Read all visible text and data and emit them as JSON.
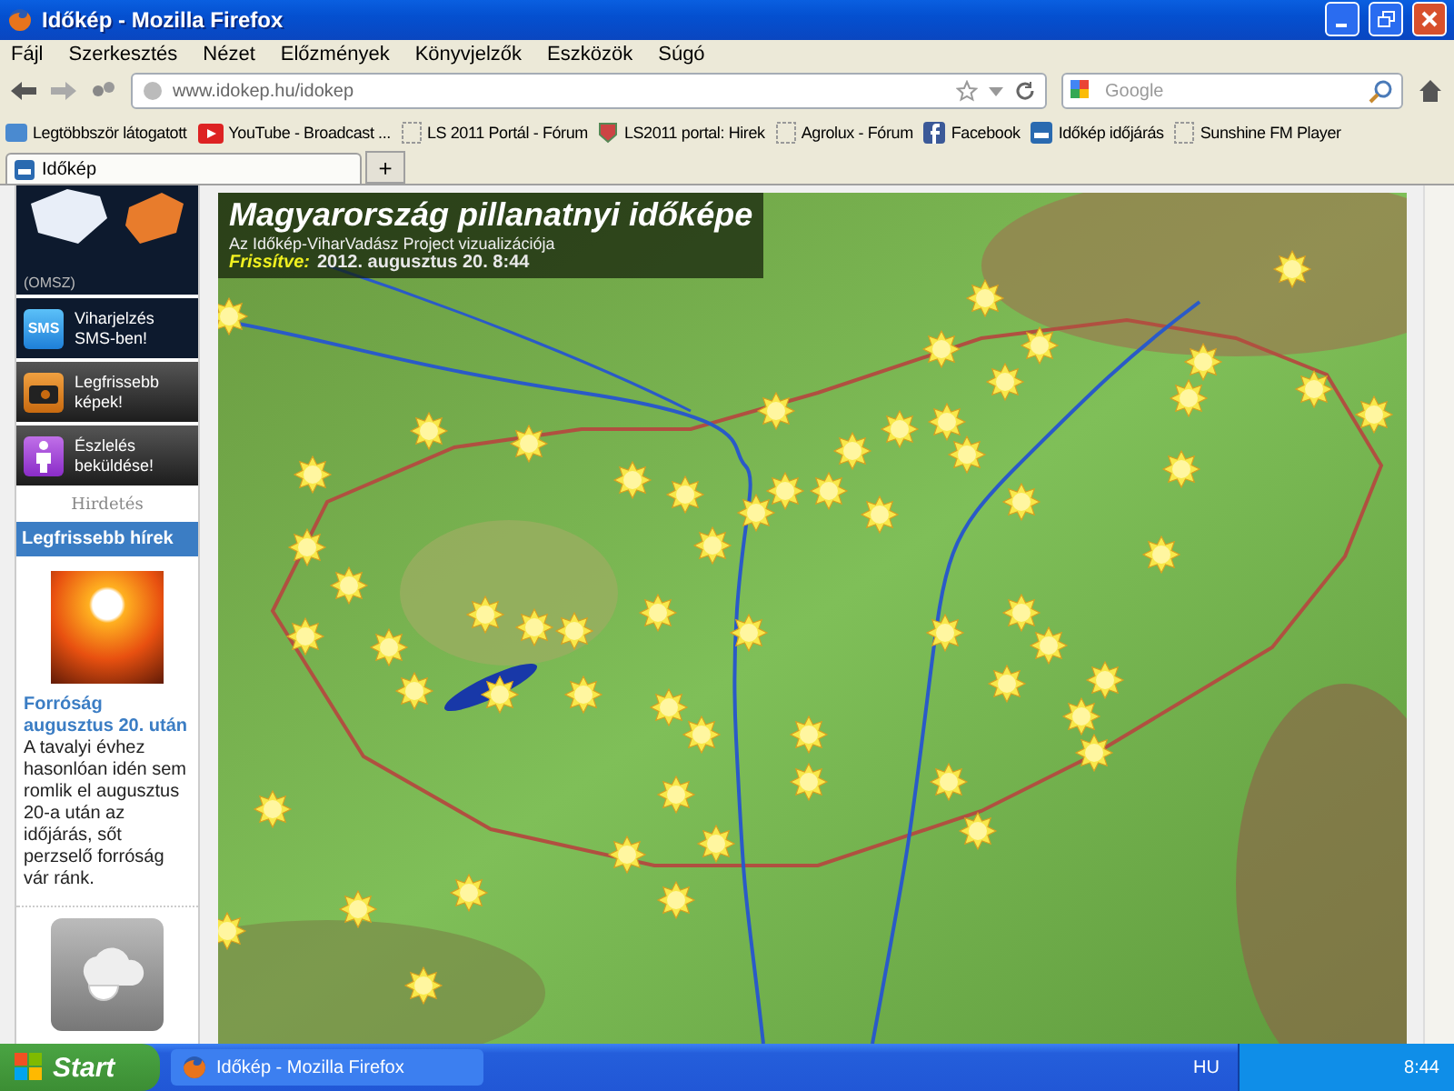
{
  "window": {
    "title": "Időkép - Mozilla Firefox"
  },
  "menu": [
    "Fájl",
    "Szerkesztés",
    "Nézet",
    "Előzmények",
    "Könyvjelzők",
    "Eszközök",
    "Súgó"
  ],
  "navigation": {
    "url": "www.idokep.hu/idokep",
    "search_placeholder": "Google"
  },
  "bookmarks": [
    {
      "kind": "most-visited",
      "label": "Legtöbbször látogatott"
    },
    {
      "kind": "video",
      "label": "YouTube - Broadcast ..."
    },
    {
      "kind": "page",
      "label": "LS 2011 Portál - Fórum"
    },
    {
      "kind": "crest",
      "label": "LS2011 portal: Hirek"
    },
    {
      "kind": "page",
      "label": "Agrolux - Fórum"
    },
    {
      "kind": "social",
      "label": "Facebook"
    },
    {
      "kind": "site",
      "label": "Időkép időjárás"
    },
    {
      "kind": "page",
      "label": "Sunshine FM Player"
    }
  ],
  "tabs": [
    {
      "label": "Időkép",
      "selected": true
    }
  ],
  "new_tab": "+",
  "sidebar": {
    "map_caption": "(OMSZ)",
    "links": [
      {
        "kind": "sms",
        "badge": "SMS",
        "label": "Viharjelzés SMS-ben!"
      },
      {
        "kind": "camera",
        "label": "Legfrissebb képek!"
      },
      {
        "kind": "person",
        "label": "Észlelés beküldése!"
      }
    ],
    "ad_label": "Hirdetés",
    "news": {
      "heading": "Legfrissebb hírek",
      "headline": "Forróság augusztus 20. után",
      "body": "A tavalyi évhez hasonlóan idén sem romlik el augusztus 20-a után az időjárás, sőt perzselő forróság vár ránk."
    }
  },
  "map": {
    "title": "Magyarország pillanatnyi időképe",
    "subtitle": "Az Időkép-ViharVadász Project vizualizációja",
    "updated_label": "Frissítve:",
    "updated_value": "2012. augusztus 20. 8:44"
  },
  "taskbar": {
    "start": "Start",
    "task": "Időkép - Mozilla Firefox",
    "language": "HU",
    "clock": "8:44"
  }
}
